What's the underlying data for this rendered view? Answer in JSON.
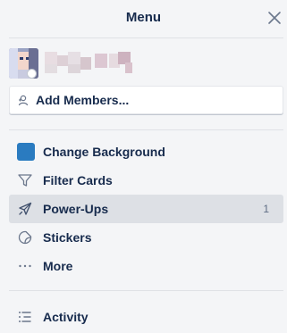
{
  "header": {
    "title": "Menu"
  },
  "members": {
    "add_label": "Add Members..."
  },
  "menu": {
    "items": [
      {
        "label": "Change Background"
      },
      {
        "label": "Filter Cards"
      },
      {
        "label": "Power-Ups",
        "count": "1"
      },
      {
        "label": "Stickers"
      },
      {
        "label": "More"
      },
      {
        "label": "Activity"
      }
    ]
  },
  "colors": {
    "background_swatch": "#2a7bc0",
    "active_item": "#dde0e5",
    "panel_bg": "#f4f5f7",
    "text": "#172b4d"
  },
  "icons": {
    "close": "close-icon",
    "add_member": "add-member-icon",
    "filter": "filter-icon",
    "power_ups": "rocket-icon",
    "stickers": "sticker-icon",
    "more": "ellipsis-icon",
    "activity": "activity-list-icon"
  }
}
